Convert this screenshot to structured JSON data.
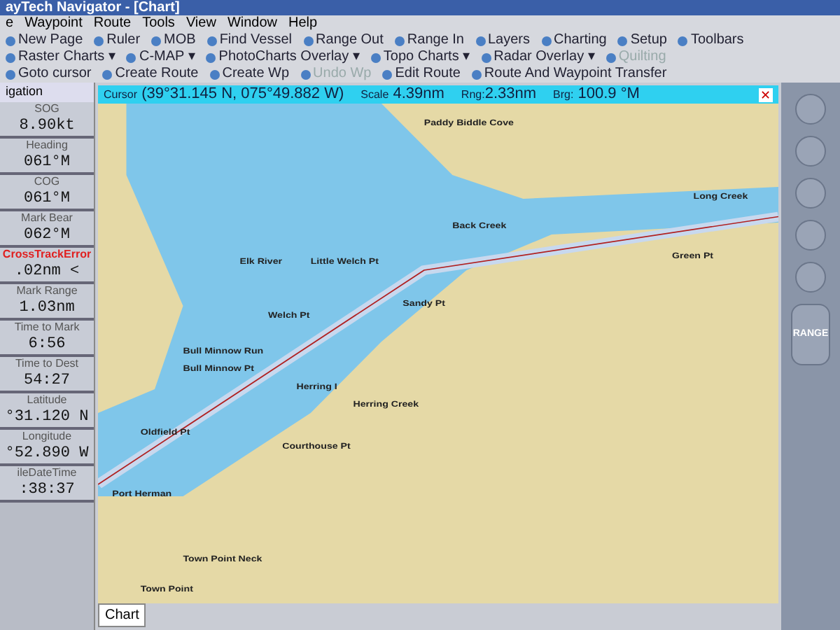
{
  "window": {
    "title": "ayTech Navigator - [Chart]"
  },
  "menu": [
    "e",
    "Waypoint",
    "Route",
    "Tools",
    "View",
    "Window",
    "Help"
  ],
  "toolbars": [
    [
      {
        "label": "New Page",
        "disabled": false
      },
      {
        "label": "Ruler",
        "disabled": false
      },
      {
        "label": "MOB",
        "disabled": false
      },
      {
        "label": "Find Vessel",
        "disabled": false
      },
      {
        "label": "Range Out",
        "disabled": false
      },
      {
        "label": "Range In",
        "disabled": false
      },
      {
        "label": "Layers",
        "disabled": false
      },
      {
        "label": "Charting",
        "disabled": false
      },
      {
        "label": "Setup",
        "disabled": false
      },
      {
        "label": "Toolbars",
        "disabled": false
      }
    ],
    [
      {
        "label": "Raster Charts ▾",
        "disabled": false
      },
      {
        "label": "C-MAP ▾",
        "disabled": false
      },
      {
        "label": "PhotoCharts Overlay ▾",
        "disabled": false
      },
      {
        "label": "Topo Charts ▾",
        "disabled": false
      },
      {
        "label": "Radar Overlay ▾",
        "disabled": false
      },
      {
        "label": "Quilting",
        "disabled": true
      }
    ],
    [
      {
        "label": "Goto cursor",
        "disabled": false
      },
      {
        "label": "Create Route",
        "disabled": false
      },
      {
        "label": "Create Wp",
        "disabled": false
      },
      {
        "label": "Undo Wp",
        "disabled": true
      },
      {
        "label": "Edit Route",
        "disabled": false
      },
      {
        "label": "Route And Waypoint Transfer",
        "disabled": false
      }
    ]
  ],
  "navigation": {
    "title": "igation",
    "fields": [
      {
        "label": "SOG",
        "value": "8.90kt",
        "alert": false
      },
      {
        "label": "Heading",
        "value": "061°M",
        "alert": false
      },
      {
        "label": "COG",
        "value": "061°M",
        "alert": false
      },
      {
        "label": "Mark Bear",
        "value": "062°M",
        "alert": false
      },
      {
        "label": "CrossTrackError",
        "value": ".02nm <",
        "alert": true
      },
      {
        "label": "Mark Range",
        "value": "1.03nm",
        "alert": false
      },
      {
        "label": "Time to Mark",
        "value": "6:56",
        "alert": false
      },
      {
        "label": "Time to Dest",
        "value": "54:27",
        "alert": false
      },
      {
        "label": "Latitude",
        "value": "°31.120 N",
        "alert": false
      },
      {
        "label": "Longitude",
        "value": "°52.890 W",
        "alert": false
      },
      {
        "label": "ileDateTime",
        "value": ":38:37",
        "alert": false
      }
    ]
  },
  "chart": {
    "cursor_label": "Cursor",
    "cursor": "(39°31.145 N, 075°49.882 W)",
    "scale_label": "Scale",
    "scale": "4.39nm",
    "rng_label": "Rng:",
    "rng": "2.33nm",
    "brg_label": "Brg:",
    "brg": "100.9 °M",
    "close": "✕",
    "places": [
      "Paddy Biddle Cove",
      "Elk River",
      "Little Welch Pt",
      "Welch Pt",
      "Bull Minnow Run",
      "Bull Minnow Pt",
      "Back Creek",
      "Sandy Pt",
      "Long Creek",
      "Green Pt",
      "Herring I",
      "Herring Creek",
      "Courthouse Pt",
      "Oldfield Pt",
      "Port Herman",
      "Town Point Neck",
      "Town Point"
    ]
  },
  "side_panel": {
    "range": "RANGE"
  },
  "tab": "Chart"
}
